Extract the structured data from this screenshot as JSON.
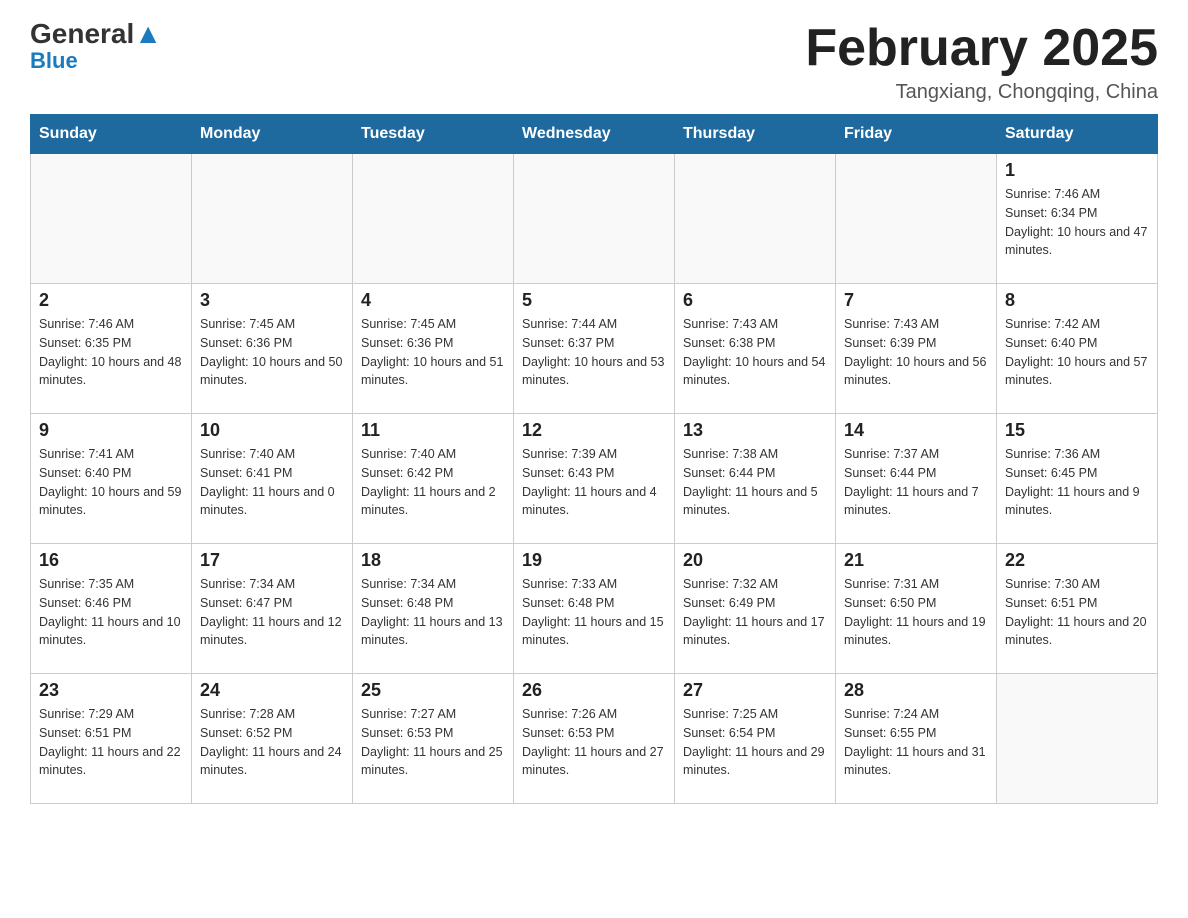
{
  "header": {
    "logo_general": "General",
    "logo_blue": "Blue",
    "title": "February 2025",
    "subtitle": "Tangxiang, Chongqing, China"
  },
  "days_of_week": [
    "Sunday",
    "Monday",
    "Tuesday",
    "Wednesday",
    "Thursday",
    "Friday",
    "Saturday"
  ],
  "weeks": [
    [
      {
        "day": "",
        "info": ""
      },
      {
        "day": "",
        "info": ""
      },
      {
        "day": "",
        "info": ""
      },
      {
        "day": "",
        "info": ""
      },
      {
        "day": "",
        "info": ""
      },
      {
        "day": "",
        "info": ""
      },
      {
        "day": "1",
        "info": "Sunrise: 7:46 AM\nSunset: 6:34 PM\nDaylight: 10 hours and 47 minutes."
      }
    ],
    [
      {
        "day": "2",
        "info": "Sunrise: 7:46 AM\nSunset: 6:35 PM\nDaylight: 10 hours and 48 minutes."
      },
      {
        "day": "3",
        "info": "Sunrise: 7:45 AM\nSunset: 6:36 PM\nDaylight: 10 hours and 50 minutes."
      },
      {
        "day": "4",
        "info": "Sunrise: 7:45 AM\nSunset: 6:36 PM\nDaylight: 10 hours and 51 minutes."
      },
      {
        "day": "5",
        "info": "Sunrise: 7:44 AM\nSunset: 6:37 PM\nDaylight: 10 hours and 53 minutes."
      },
      {
        "day": "6",
        "info": "Sunrise: 7:43 AM\nSunset: 6:38 PM\nDaylight: 10 hours and 54 minutes."
      },
      {
        "day": "7",
        "info": "Sunrise: 7:43 AM\nSunset: 6:39 PM\nDaylight: 10 hours and 56 minutes."
      },
      {
        "day": "8",
        "info": "Sunrise: 7:42 AM\nSunset: 6:40 PM\nDaylight: 10 hours and 57 minutes."
      }
    ],
    [
      {
        "day": "9",
        "info": "Sunrise: 7:41 AM\nSunset: 6:40 PM\nDaylight: 10 hours and 59 minutes."
      },
      {
        "day": "10",
        "info": "Sunrise: 7:40 AM\nSunset: 6:41 PM\nDaylight: 11 hours and 0 minutes."
      },
      {
        "day": "11",
        "info": "Sunrise: 7:40 AM\nSunset: 6:42 PM\nDaylight: 11 hours and 2 minutes."
      },
      {
        "day": "12",
        "info": "Sunrise: 7:39 AM\nSunset: 6:43 PM\nDaylight: 11 hours and 4 minutes."
      },
      {
        "day": "13",
        "info": "Sunrise: 7:38 AM\nSunset: 6:44 PM\nDaylight: 11 hours and 5 minutes."
      },
      {
        "day": "14",
        "info": "Sunrise: 7:37 AM\nSunset: 6:44 PM\nDaylight: 11 hours and 7 minutes."
      },
      {
        "day": "15",
        "info": "Sunrise: 7:36 AM\nSunset: 6:45 PM\nDaylight: 11 hours and 9 minutes."
      }
    ],
    [
      {
        "day": "16",
        "info": "Sunrise: 7:35 AM\nSunset: 6:46 PM\nDaylight: 11 hours and 10 minutes."
      },
      {
        "day": "17",
        "info": "Sunrise: 7:34 AM\nSunset: 6:47 PM\nDaylight: 11 hours and 12 minutes."
      },
      {
        "day": "18",
        "info": "Sunrise: 7:34 AM\nSunset: 6:48 PM\nDaylight: 11 hours and 13 minutes."
      },
      {
        "day": "19",
        "info": "Sunrise: 7:33 AM\nSunset: 6:48 PM\nDaylight: 11 hours and 15 minutes."
      },
      {
        "day": "20",
        "info": "Sunrise: 7:32 AM\nSunset: 6:49 PM\nDaylight: 11 hours and 17 minutes."
      },
      {
        "day": "21",
        "info": "Sunrise: 7:31 AM\nSunset: 6:50 PM\nDaylight: 11 hours and 19 minutes."
      },
      {
        "day": "22",
        "info": "Sunrise: 7:30 AM\nSunset: 6:51 PM\nDaylight: 11 hours and 20 minutes."
      }
    ],
    [
      {
        "day": "23",
        "info": "Sunrise: 7:29 AM\nSunset: 6:51 PM\nDaylight: 11 hours and 22 minutes."
      },
      {
        "day": "24",
        "info": "Sunrise: 7:28 AM\nSunset: 6:52 PM\nDaylight: 11 hours and 24 minutes."
      },
      {
        "day": "25",
        "info": "Sunrise: 7:27 AM\nSunset: 6:53 PM\nDaylight: 11 hours and 25 minutes."
      },
      {
        "day": "26",
        "info": "Sunrise: 7:26 AM\nSunset: 6:53 PM\nDaylight: 11 hours and 27 minutes."
      },
      {
        "day": "27",
        "info": "Sunrise: 7:25 AM\nSunset: 6:54 PM\nDaylight: 11 hours and 29 minutes."
      },
      {
        "day": "28",
        "info": "Sunrise: 7:24 AM\nSunset: 6:55 PM\nDaylight: 11 hours and 31 minutes."
      },
      {
        "day": "",
        "info": ""
      }
    ]
  ]
}
